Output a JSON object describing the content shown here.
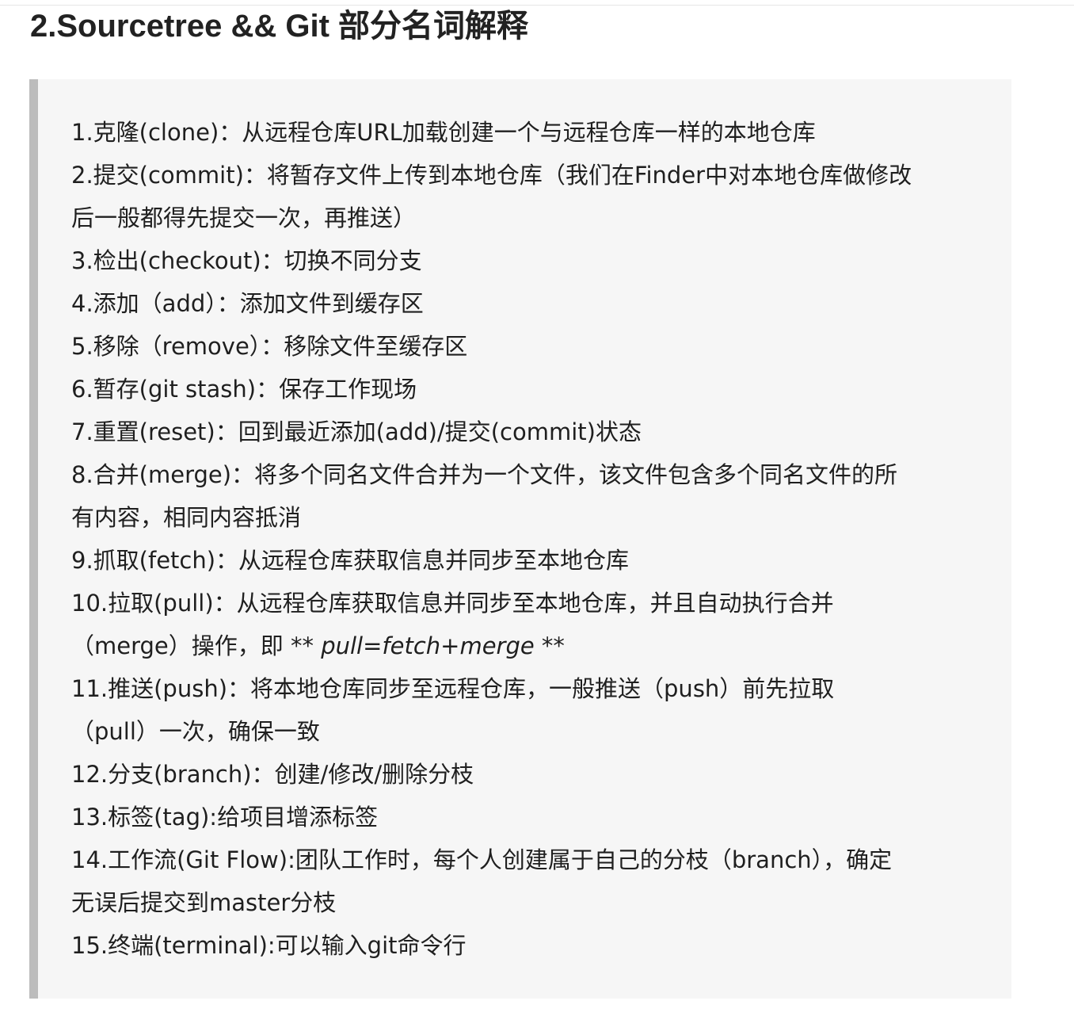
{
  "heading": "2.Sourcetree && Git 部分名词解释",
  "terms": [
    {
      "text": "1.克隆(clone)：从远程仓库URL加载创建一个与远程仓库一样的本地仓库"
    },
    {
      "text": "2.提交(commit)：将暂存文件上传到本地仓库（我们在Finder中对本地仓库做修改"
    },
    {
      "text": "后一般都得先提交一次，再推送）"
    },
    {
      "text": "3.检出(checkout)：切换不同分支"
    },
    {
      "text": "4.添加（add）：添加文件到缓存区"
    },
    {
      "text": "5.移除（remove）：移除文件至缓存区"
    },
    {
      "text": "6.暂存(git stash)：保存工作现场"
    },
    {
      "text": "7.重置(reset)：回到最近添加(add)/提交(commit)状态"
    },
    {
      "text": "8.合并(merge)：将多个同名文件合并为一个文件，该文件包含多个同名文件的所"
    },
    {
      "text": "有内容，相同内容抵消"
    },
    {
      "text": "9.抓取(fetch)：从远程仓库获取信息并同步至本地仓库"
    },
    {
      "text": "10.拉取(pull)：从远程仓库获取信息并同步至本地仓库，并且自动执行合并"
    },
    {
      "prefix": "（merge）操作，即 ** ",
      "em": "pull=fetch+merge",
      "suffix": " **"
    },
    {
      "text": "11.推送(push)：将本地仓库同步至远程仓库，一般推送（push）前先拉取"
    },
    {
      "text": "（pull）一次，确保一致"
    },
    {
      "text": "12.分支(branch)：创建/修改/删除分枝"
    },
    {
      "text": "13.标签(tag):给项目增添标签"
    },
    {
      "text": "14.工作流(Git Flow):团队工作时，每个人创建属于自己的分枝（branch），确定"
    },
    {
      "text": "无误后提交到master分枝"
    },
    {
      "text": "15.终端(terminal):可以输入git命令行"
    }
  ]
}
